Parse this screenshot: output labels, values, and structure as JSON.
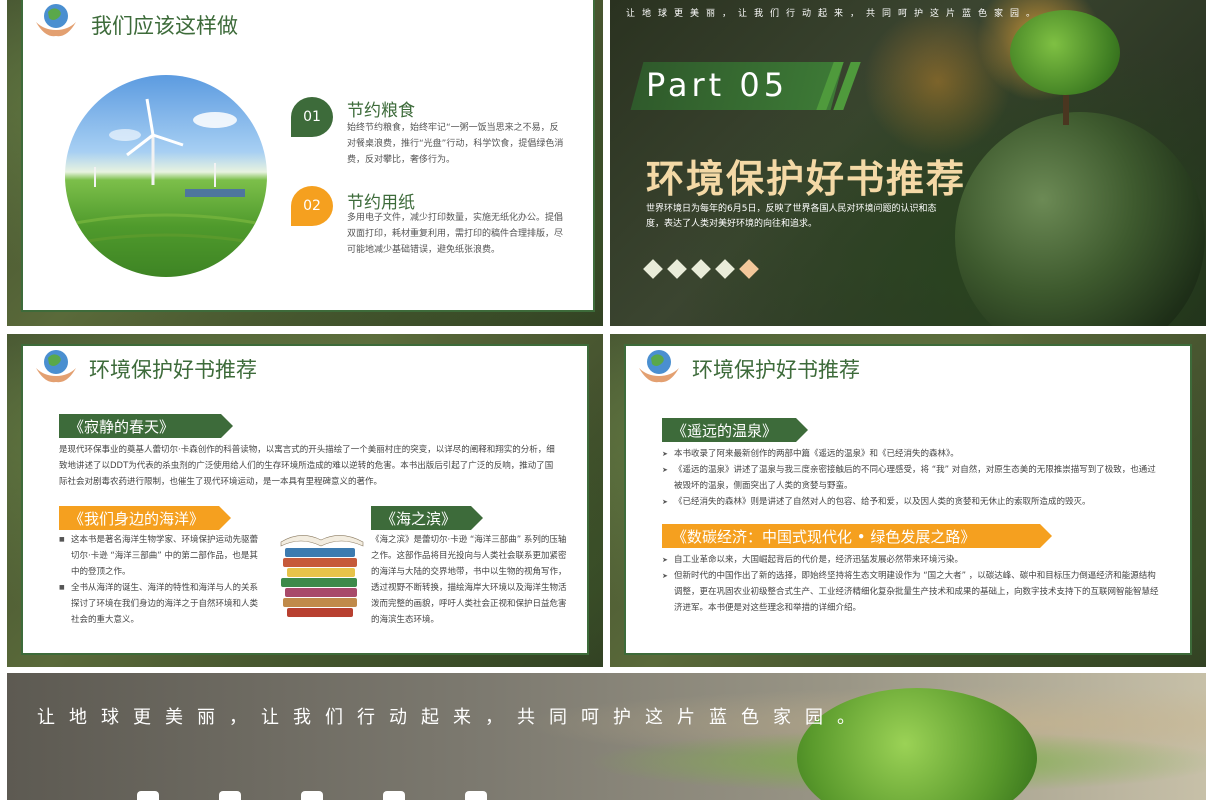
{
  "slide1": {
    "title": "我们应该这样做",
    "items": [
      {
        "num": "01",
        "title": "节约粮食",
        "text": "始终节约粮食，始终牢记“一粥一饭当思来之不易，反对餐桌浪费，推行“光盘”行动，科学饮食，提倡绿色消费，反对攀比，奢侈行为。"
      },
      {
        "num": "02",
        "title": "节约用纸",
        "text": "多用电子文件，减少打印数量，实施无纸化办公。提倡双面打印，耗材重复利用，需打印的稿件合理排版，尽可能地减少基础错误，避免纸张浪费。"
      }
    ]
  },
  "slide2": {
    "caption": "让地球更美丽，让我们行动起来，共同呵护这片蓝色家园。",
    "part": "Part 05",
    "title": "环境保护好书推荐",
    "desc": "世界环境日为每年的6月5日，反映了世界各国人民对环境问题的认识和态度，表达了人类对美好环境的向往和追求。"
  },
  "slide3": {
    "title": "环境保护好书推荐",
    "book1_title": "《寂静的春天》",
    "book1_text": "是现代环保事业的奠基人蕾切尔·卡森创作的科普读物，以寓言式的开头描绘了一个美丽村庄的突变，以详尽的阐释和翔实的分析，细致地讲述了以DDT为代表的杀虫剂的广泛使用给人们的生存环境所造成的难以逆转的危害。本书出版后引起了广泛的反响，推动了国际社会对剧毒农药进行限制，也催生了现代环境运动，是一本具有里程碑意义的著作。",
    "book2_title": "《我们身边的海洋》",
    "book2_bullets": [
      "这本书是著名海洋生物学家、环境保护运动先驱蕾切尔·卡逊 “海洋三部曲” 中的第二部作品，也是其中的登顶之作。",
      "全书从海洋的诞生、海洋的特性和海洋与人的关系探讨了环境在我们身边的海洋之于自然环境和人类社会的重大意义。"
    ],
    "book3_title": "《海之滨》",
    "book3_text": "《海之滨》是蕾切尔·卡逊 “海洋三部曲” 系列的压轴之作。这部作品将目光投向与人类社会联系更加紧密的海洋与大陆的交界地带，书中以生物的视角写作，透过视野不断转换，描绘海岸大环境以及海洋生物活泼而完整的画貌，呼吁人类社会正视和保护日益危害的海滨生态环境。"
  },
  "slide4": {
    "title": "环境保护好书推荐",
    "book1_title": "《遥远的温泉》",
    "book1_bullets": [
      "本书收录了阿来最新创作的两部中篇《遥远的温泉》和《已经消失的森林》。",
      "《遥远的温泉》讲述了温泉与我三度亲密接触后的不同心理感受，将 “我” 对自然，对原生态美的无限推崇描写到了极致，也通过被毁坏的温泉，侧面突出了人类的贪婪与野蛮。",
      "《已经消失的森林》则是讲述了自然对人的包容、给予和爱，以及因人类的贪婪和无休止的索取所造成的毁灭。"
    ],
    "book2_title": "《数碳经济：中国式现代化 • 绿色发展之路》",
    "book2_bullets": [
      "自工业革命以来，大国崛起背后的代价是，经济迅猛发展必然带来环境污染。",
      "但新时代的中国作出了新的选择，即始终坚持将生态文明建设作为 “国之大者” ，以碳达峰、碳中和目标压力倒逼经济和能源结构调整，更在巩固农业初级整合式生产、工业经济精细化复杂批量生产技术和成果的基础上，向数字技术支持下的互联网智能智慧经济进军。本书便是对这些理念和举措的详细介绍。"
    ]
  },
  "slide5": {
    "caption": "让地球更美丽，让我们行动起来，共同呵护这片蓝色家园。"
  }
}
